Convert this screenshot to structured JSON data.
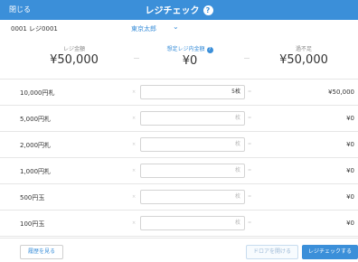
{
  "header": {
    "close_label": "閉じる",
    "title": "レジチェック",
    "info_glyph": "?"
  },
  "subheader": {
    "register_id": "0001 レジ0001",
    "store_name": "東京太郎",
    "chevron_glyph": "⌄"
  },
  "summary": {
    "register_amount": {
      "label": "レジ金額",
      "value": "¥50,000"
    },
    "expected_amount": {
      "label": "想定レジ内金額",
      "value": "¥0",
      "help_glyph": "?"
    },
    "difference": {
      "label": "過不足",
      "value": "¥50,000"
    },
    "separator": "-"
  },
  "rows": [
    {
      "denomination": "10,000円札",
      "quantity": "5枚",
      "amount": "¥50,000"
    },
    {
      "denomination": "5,000円札",
      "placeholder": "枚",
      "amount": "¥0"
    },
    {
      "denomination": "2,000円札",
      "placeholder": "枚",
      "amount": "¥0"
    },
    {
      "denomination": "1,000円札",
      "placeholder": "枚",
      "amount": "¥0"
    },
    {
      "denomination": "500円玉",
      "placeholder": "枚",
      "amount": "¥0"
    },
    {
      "denomination": "100円玉",
      "placeholder": "枚",
      "amount": "¥0"
    }
  ],
  "ops": {
    "multiply": "×",
    "equals": "="
  },
  "footer": {
    "history_label": "履歴を見る",
    "open_drawer_label": "ドロアを開ける",
    "register_check_label": "レジチェックする"
  },
  "colors": {
    "accent": "#3b8fd9",
    "border": "#e6e6e6"
  }
}
